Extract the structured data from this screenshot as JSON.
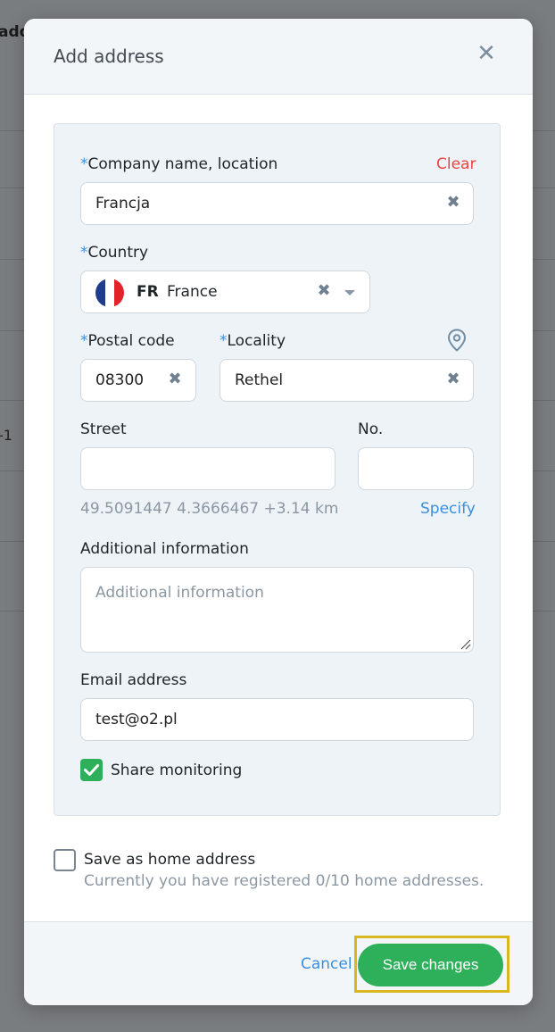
{
  "background": {
    "heading": "add",
    "row_text": "-1"
  },
  "modal": {
    "title": "Add address",
    "close_icon": "close-icon",
    "company": {
      "label": "Company name, location",
      "clear_label": "Clear",
      "value": "Francja"
    },
    "country": {
      "label": "Country",
      "code": "FR",
      "name": "France",
      "flag_colors": [
        "#1f3c91",
        "#ffffff",
        "#e3232b"
      ]
    },
    "postal": {
      "label": "Postal code",
      "value": "08300"
    },
    "locality": {
      "label": "Locality",
      "value": "Rethel"
    },
    "street": {
      "label": "Street",
      "value": ""
    },
    "number": {
      "label": "No.",
      "value": ""
    },
    "coordinates": "49.5091447 4.3666467 +3.14 km",
    "specify_label": "Specify",
    "additional_info": {
      "label": "Additional information",
      "placeholder": "Additional information"
    },
    "email": {
      "label": "Email address",
      "value": "test@o2.pl"
    },
    "share_monitoring": {
      "label": "Share monitoring",
      "checked": true
    },
    "home_address": {
      "label": "Save as home address",
      "subtext": "Currently you have registered 0/10 home addresses.",
      "checked": false
    },
    "footer": {
      "cancel_label": "Cancel",
      "save_label": "Save changes"
    }
  },
  "colors": {
    "accent_blue": "#3b8fe0",
    "green": "#2eb05b",
    "red": "#e8453f",
    "highlight": "#d9b81f"
  }
}
